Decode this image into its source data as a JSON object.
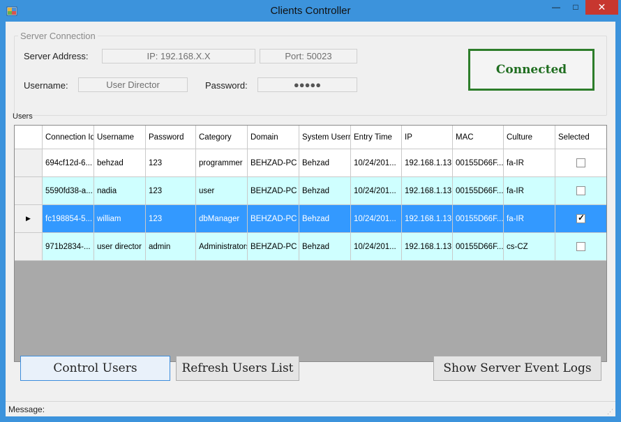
{
  "window": {
    "title": "Clients Controller",
    "minimize_glyph": "—",
    "maximize_glyph": "□",
    "close_glyph": "✕"
  },
  "server": {
    "group_label": "Server Connection",
    "address_label": "Server Address:",
    "ip_value": "IP: 192.168.X.X",
    "port_value": "Port: 50023",
    "username_label": "Username:",
    "username_value": "User Director",
    "password_label": "Password:",
    "password_value": "●●●●●",
    "status": "Connected",
    "status_color": "#2d7d2a"
  },
  "users": {
    "label": "Users",
    "columns": [
      {
        "label": "Connection Id"
      },
      {
        "label": "Username"
      },
      {
        "label": "Password"
      },
      {
        "label": "Category"
      },
      {
        "label": "Domain"
      },
      {
        "label": "System Username"
      },
      {
        "label": "Entry Time"
      },
      {
        "label": "IP"
      },
      {
        "label": "MAC"
      },
      {
        "label": "Culture"
      },
      {
        "label": "Selected"
      }
    ],
    "rows": [
      {
        "connection_id": "694cf12d-6...",
        "username": "behzad",
        "password": "123",
        "category": "programmer",
        "domain": "BEHZAD-PC",
        "system_username": "Behzad",
        "entry_time": "10/24/201...",
        "ip": "192.168.1.13",
        "mac": "00155D66F...",
        "culture": "fa-IR",
        "selected": false
      },
      {
        "connection_id": "5590fd38-a...",
        "username": "nadia",
        "password": "123",
        "category": "user",
        "domain": "BEHZAD-PC",
        "system_username": "Behzad",
        "entry_time": "10/24/201...",
        "ip": "192.168.1.13",
        "mac": "00155D66F...",
        "culture": "fa-IR",
        "selected": false
      },
      {
        "connection_id": "fc198854-5...",
        "username": "william",
        "password": "123",
        "category": "dbManager",
        "domain": "BEHZAD-PC",
        "system_username": "Behzad",
        "entry_time": "10/24/201...",
        "ip": "192.168.1.13",
        "mac": "00155D66F...",
        "culture": "fa-IR",
        "selected": true
      },
      {
        "connection_id": "971b2834-...",
        "username": "user director",
        "password": "admin",
        "category": "Administrators",
        "domain": "BEHZAD-PC",
        "system_username": "Behzad",
        "entry_time": "10/24/201...",
        "ip": "192.168.1.13",
        "mac": "00155D66F...",
        "culture": "cs-CZ",
        "selected": false
      }
    ],
    "current_row_glyph": "▶",
    "selection_color": "#3399ff",
    "alt_row_color": "#cfffff"
  },
  "buttons": {
    "control_users": "Control Users",
    "refresh_users": "Refresh Users List",
    "show_logs": "Show Server Event Logs"
  },
  "status": {
    "message_label": "Message:"
  }
}
